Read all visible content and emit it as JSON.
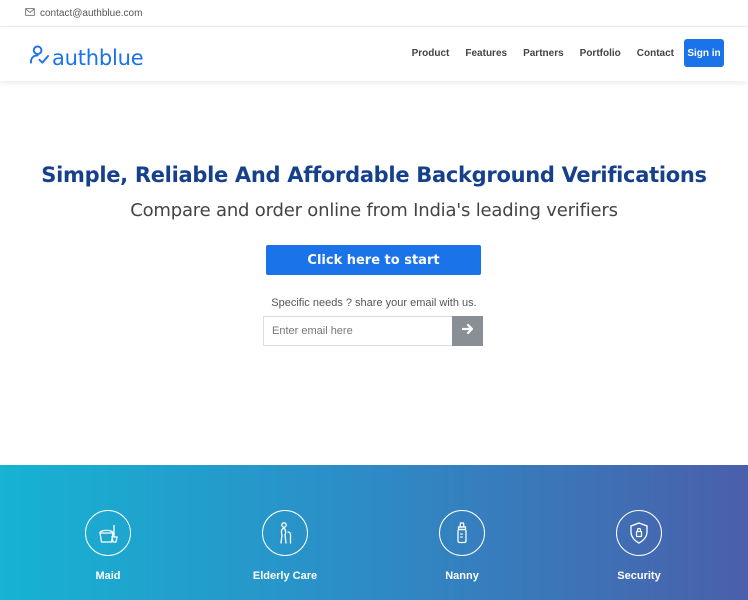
{
  "topbar": {
    "email": "contact@authblue.com",
    "email_icon": "envelope-icon"
  },
  "navbar": {
    "logo_text": "authblue",
    "links": [
      "Product",
      "Features",
      "Partners",
      "Portfolio",
      "Contact"
    ],
    "signin_label": "Sign in"
  },
  "hero": {
    "title": "Simple, Reliable And Affordable Background Verifications",
    "subtitle": "Compare and order online from India's leading verifiers",
    "cta_label": "Click here to start",
    "specific_text": "Specific needs ? share your email with us.",
    "email_placeholder": "Enter email here",
    "submit_icon": "arrow-right-icon"
  },
  "categories": [
    {
      "label": "Maid",
      "icon": "cleaning-bucket-icon"
    },
    {
      "label": "Elderly Care",
      "icon": "elderly-person-icon"
    },
    {
      "label": "Nanny",
      "icon": "baby-bottle-icon"
    },
    {
      "label": "Security",
      "icon": "shield-icon"
    }
  ],
  "colors": {
    "accent": "#1a73e8",
    "title": "#16408c",
    "band_start": "#16b3d3",
    "band_end": "#4a5fab"
  }
}
